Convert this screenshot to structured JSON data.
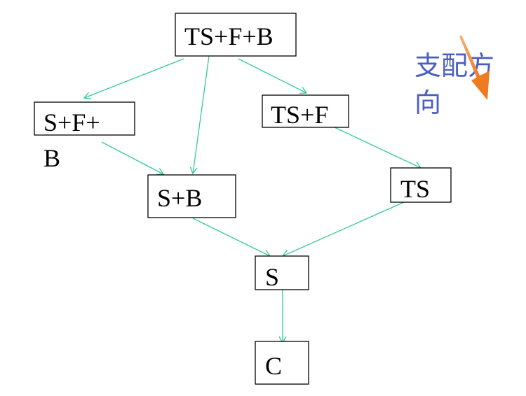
{
  "colors": {
    "edge": "#33cc99",
    "box_border": "#000000",
    "text": "#000000",
    "direction_text": "#4a5fc1",
    "direction_arrow": "#f08a3c"
  },
  "nodes": {
    "ts_f_b": {
      "label": "TS+F+B"
    },
    "s_f_b": {
      "label_line1": "S+F+",
      "label_line2": "B"
    },
    "ts_f": {
      "label": "TS+F"
    },
    "s_b": {
      "label": "S+B"
    },
    "ts": {
      "label": "TS"
    },
    "s": {
      "label": "S"
    },
    "c": {
      "label": "C"
    }
  },
  "edges": [
    {
      "from": "TS+F+B",
      "to": "S+F+B"
    },
    {
      "from": "TS+F+B",
      "to": "S+B"
    },
    {
      "from": "TS+F+B",
      "to": "TS+F"
    },
    {
      "from": "S+F+B",
      "to": "S+B"
    },
    {
      "from": "TS+F",
      "to": "TS"
    },
    {
      "from": "S+B",
      "to": "S"
    },
    {
      "from": "TS",
      "to": "S"
    },
    {
      "from": "S",
      "to": "C"
    }
  ],
  "direction_label": {
    "line1": "支配方",
    "line2": "向",
    "icon": "orange-arrow-icon"
  }
}
